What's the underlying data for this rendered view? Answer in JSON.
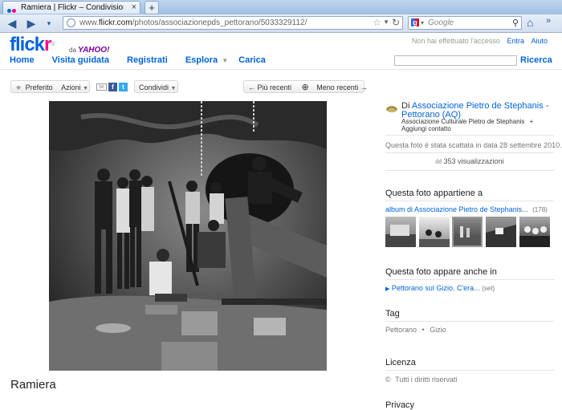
{
  "browser": {
    "tab_title": "Ramiera | Flickr – Condivisione di foto!",
    "tab_close": "×",
    "new_tab": "+",
    "url_prefix": "www.",
    "url_host": "flickr.com",
    "url_path": "/photos/associazionepds_pettorano/5033329112/",
    "search_placeholder": "Google"
  },
  "flickr": {
    "logo_fl": "flick",
    "logo_kr": "r",
    "logo_reg": "®",
    "by": "da",
    "yahoo": "YAHOO!",
    "not_logged": "Non hai effettuato l'accesso",
    "login": "Entra",
    "help": "Aiuto",
    "nav": {
      "home": "Home",
      "tour": "Visita guidata",
      "signup": "Registrati",
      "explore": "Esplora",
      "upload": "Carica"
    },
    "search_button": "Ricerca"
  },
  "toolbar": {
    "favorite": "Preferito",
    "actions": "Azioni",
    "share": "Condividi",
    "newer": "← Più recenti",
    "older": "Meno recenti →"
  },
  "photo": {
    "title": "Ramiera"
  },
  "sidebar": {
    "by_prefix": "Di",
    "owner": "Associazione Pietro de Stephanis - Pettorano (AQ)",
    "owner_line1": "Associazione Pietro de Stephanis -",
    "owner_line2": "Pettorano (AQ)",
    "owner_sub": "Associazione Culturale Pietro de Stephanis",
    "add_contact": "Aggiungi contatto",
    "plus": "+",
    "taken": "Questa foto è stata scattata in data 28 settembre 2010.",
    "views": "353 visualizzazioni",
    "belongs_head": "Questa foto appartiene a",
    "album": "album di Associazione Pietro de Stephanis...",
    "album_count": "(178)",
    "also_in_head": "Questa foto appare anche in",
    "set_name": "Pettorano sul Gizio. C'era...",
    "set_label": "(set)",
    "tag_head": "Tag",
    "tags": [
      "Pettorano",
      "Gizio"
    ],
    "tag_sep": "•",
    "license_head": "Licenza",
    "license": "Tutti i diritti riservati",
    "privacy_head": "Privacy"
  },
  "colors": {
    "flickr_blue": "#0063dc",
    "flickr_pink": "#ff0084"
  }
}
